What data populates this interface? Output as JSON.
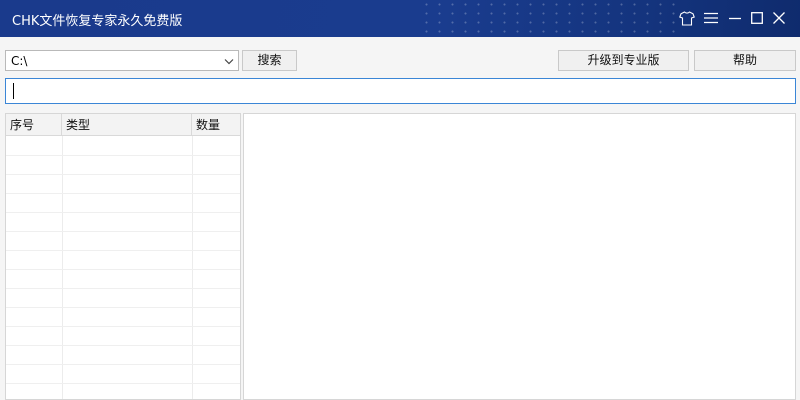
{
  "window": {
    "title": "CHK文件恢复专家永久免费版"
  },
  "titlebar_icons": [
    "shirt-icon",
    "menu-icon",
    "minimize-icon",
    "maximize-icon",
    "close-icon"
  ],
  "toolbar": {
    "drive_value": "C:\\",
    "search_label": "搜索",
    "upgrade_label": "升级到专业版",
    "help_label": "帮助"
  },
  "filter": {
    "value": ""
  },
  "table": {
    "columns": [
      "序号",
      "类型",
      "数量"
    ],
    "rows": []
  },
  "colors": {
    "titlebar": "#1a3a8c",
    "focus_border": "#3b86d6"
  }
}
